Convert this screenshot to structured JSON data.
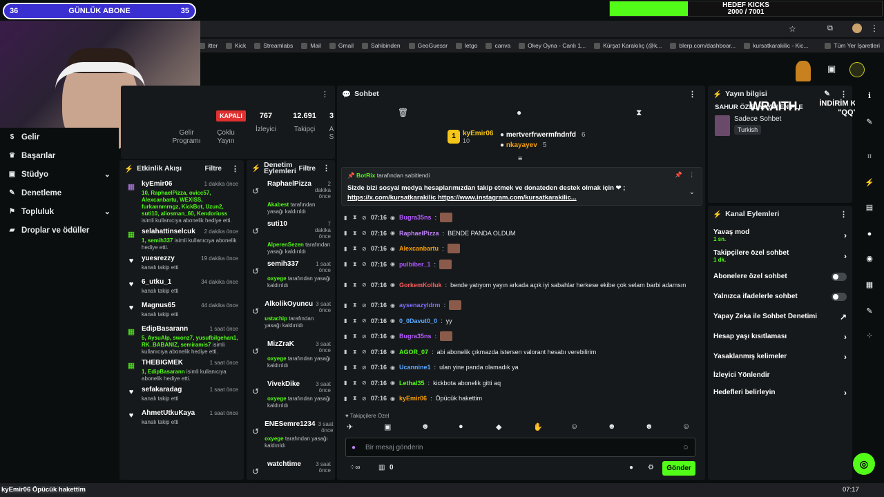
{
  "overlay": {
    "sub_goal": {
      "left": "36",
      "label": "GÜNLÜK ABONE",
      "right": "35"
    },
    "kick_goal": {
      "title": "HEDEF KICKS",
      "value": "2000 / 7001",
      "progress": 0.286
    }
  },
  "bookmarks": [
    "itter",
    "Kick",
    "Streamlabs",
    "Mail",
    "Gmail",
    "Sahibinden",
    "GeoGuessr",
    "letgo",
    "canva",
    "Okey Oyna - Canlı 1...",
    "Kürşat Karakılıç (@k...",
    "blerp.com/dashboar...",
    "kursatkarakilic - Kic...",
    "Tüm Yer İşaretleri"
  ],
  "leftnav": [
    {
      "label": "Gelir",
      "icon": "dollar-icon"
    },
    {
      "label": "Başarılar",
      "icon": "trophy-icon"
    },
    {
      "label": "Stüdyo",
      "icon": "studio-icon",
      "chev": "⌄"
    },
    {
      "label": "Denetleme",
      "icon": "wrench-icon"
    },
    {
      "label": "Topluluk",
      "icon": "users-icon",
      "chev": "⌄"
    },
    {
      "label": "Droplar ve ödüller",
      "icon": "gift-icon"
    }
  ],
  "stats": {
    "income_label": "Gelir Programı",
    "status": "KAPALI",
    "status_label": "Çoklu Yayın",
    "viewers": "767",
    "viewers_label": "İzleyici",
    "followers": "12.691",
    "followers_label": "Takipçi",
    "extra": "3",
    "extra_label": "A S"
  },
  "feed": {
    "title": "Etkinlik Akışı",
    "filter": "Filtre",
    "items": [
      {
        "name": "kyEmir06",
        "time": "1 dakika önce",
        "green": "10, RaphaelPizza, ovicc57, Alexcanbartu, WEXISS, furkannmrngz, KickBot, Uzun2, suti10, aliosman_60, Kendoriuss",
        "text": "isimli kullanıcıya abonelik hediye etti.",
        "icon": "gift-icon"
      },
      {
        "name": "selahattinselcuk",
        "time": "2 dakika önce",
        "green": "1, semih337",
        "text": "isimli kullanıcıya abonelik hediye etti.",
        "icon": "gift-icon"
      },
      {
        "name": "yuesrezzy",
        "time": "19 dakika önce",
        "green": "",
        "text": "kanalı takip etti",
        "icon": "heart-icon"
      },
      {
        "name": "6_utku_1",
        "time": "34 dakika önce",
        "green": "",
        "text": "kanalı takip etti",
        "icon": "heart-icon"
      },
      {
        "name": "Magnus65",
        "time": "44 dakika önce",
        "green": "",
        "text": "kanalı takip etti",
        "icon": "heart-icon"
      },
      {
        "name": "EdipBasarann",
        "time": "1 saat önce",
        "green": "5, AysuAlp, swonz7, yusufbilgehan1, RK_BABANIZ, semiramis7",
        "text": "isimli kullanıcıya abonelik hediye etti.",
        "icon": "gift-icon"
      },
      {
        "name": "THEBIGMEK",
        "time": "1 saat önce",
        "green": "1, EdipBasarann",
        "text": "isimli kullanıcıya abonelik hediye etti.",
        "icon": "gift-icon"
      },
      {
        "name": "sefakaradag",
        "time": "1 saat önce",
        "green": "",
        "text": "kanalı takip etti",
        "icon": "heart-icon"
      },
      {
        "name": "AhmetUtkuKaya",
        "time": "1 saat önce",
        "green": "",
        "text": "kanalı takip etti",
        "icon": "heart-icon"
      }
    ]
  },
  "mod": {
    "title": "Denetim Eylemleri",
    "filter": "Filtre",
    "items": [
      {
        "name": "RaphaelPizza",
        "time": "2 dakika önce",
        "by": "Akabest",
        "text": "tarafından yasağı kaldırıldı"
      },
      {
        "name": "suti10",
        "time": "7 dakika önce",
        "by": "AlperenSezen",
        "text": "tarafından yasağı kaldırıldı"
      },
      {
        "name": "semih337",
        "time": "1 saat önce",
        "by": "oxyege",
        "text": "tarafından yasağı kaldırıldı"
      },
      {
        "name": "AlkolikOyuncu",
        "time": "3 saat önce",
        "by": "ustachip",
        "text": "tarafından yasağı kaldırıldı"
      },
      {
        "name": "MizZraK",
        "time": "3 saat önce",
        "by": "oxyege",
        "text": "tarafından yasağı kaldırıldı"
      },
      {
        "name": "VivekDike",
        "time": "3 saat önce",
        "by": "oxyege",
        "text": "tarafından yasağı kaldırıldı"
      },
      {
        "name": "ENESemre1234",
        "time": "3 saat önce",
        "by": "oxyege",
        "text": "tarafından yasağı kaldırıldı"
      },
      {
        "name": "watchtime",
        "time": "3 saat önce",
        "by": "",
        "text": ""
      }
    ]
  },
  "chat": {
    "title": "Sohbet",
    "gifters": [
      {
        "name": "kyEmir06",
        "count": "10"
      },
      {
        "name": "mertverfrwermfndnfd",
        "count": "6"
      },
      {
        "name": "nkayayev",
        "count": "5"
      }
    ],
    "pinned": {
      "by": "BotRix",
      "by_suffix": "tarafından sabitlendi",
      "text": "Sizde bizi sosyal medya hesaplarımızdan takip etmek ve donateden destek olmak için ❤ ;",
      "links": "https://x.com/kursatkarakilic https://www.instagram.com/kursatkarakilic..."
    },
    "messages": [
      {
        "time": "07:16",
        "user": "Bugra35ns",
        "color": "#b65cff",
        "text": "",
        "emote": true
      },
      {
        "time": "07:16",
        "user": "RaphaelPizza",
        "color": "#c084fc",
        "text": "BENDE PANDA OLDUM",
        "emote": false
      },
      {
        "time": "07:16",
        "user": "Alexcanbartu",
        "color": "#f59e0b",
        "text": "",
        "emote": true
      },
      {
        "time": "07:16",
        "user": "pulbiber_1",
        "color": "#a855f7",
        "text": "",
        "emote": true
      },
      {
        "time": "07:16",
        "user": "GorkemKolluk",
        "color": "#ff5c5c",
        "text": "bende yatıyom yayın arkada açık iyi sabahlar herkese ekibe çok selam barbi adamsın",
        "emote": false
      },
      {
        "time": "07:16",
        "user": "aysenazyldrm",
        "color": "#7c6cff",
        "text": "",
        "emote": true
      },
      {
        "time": "07:16",
        "user": "0_0Davut0_0",
        "color": "#5aa9ff",
        "text": "yy",
        "emote": false
      },
      {
        "time": "07:16",
        "user": "Bugra35ns",
        "color": "#b65cff",
        "text": "",
        "emote": true
      },
      {
        "time": "07:16",
        "user": "AGOR_07",
        "color": "#53fc18",
        "text": "abi abonelik çıkmazda istersen valorant hesabı verebilirim",
        "emote": false
      },
      {
        "time": "07:16",
        "user": "Ucannine1",
        "color": "#5aa9ff",
        "text": "ulan yine panda olamadık ya",
        "emote": false
      },
      {
        "time": "07:16",
        "user": "Lethal35",
        "color": "#53fc18",
        "text": "kickbota abonelik gitti aq",
        "emote": false
      },
      {
        "time": "07:16",
        "user": "kyEmir06",
        "color": "#f59e0b",
        "text": "Öpücük hakettim",
        "emote": false
      }
    ],
    "followers_only": "Takipçilere Özel",
    "input_placeholder": "Bir mesaj gönderin",
    "points": "0",
    "send_label": "Gönder"
  },
  "streaminfo": {
    "title": "Yayın bilgisi",
    "stream_title": "SAHUR ÖZEL YAYIN ENİFLE",
    "category": "Sadece Sohbet",
    "language": "Turkish"
  },
  "overlay_text": {
    "wraith": "WRAITH.",
    "discount": "İNDİRİM KODU: \"QQ\""
  },
  "actions": {
    "title": "Kanal Eylemleri",
    "items": [
      {
        "label": "Yavaş mod",
        "sub": "1 sn.",
        "kind": "chev"
      },
      {
        "label": "Takipçilere özel sohbet",
        "sub": "1 dk.",
        "kind": "chev"
      },
      {
        "label": "Abonelere özel sohbet",
        "sub": "",
        "kind": "toggle"
      },
      {
        "label": "Yalnızca ifadelerle sohbet",
        "sub": "",
        "kind": "toggle"
      },
      {
        "label": "Yapay Zeka ile Sohbet Denetimi",
        "sub": "",
        "kind": "ext"
      },
      {
        "label": "Hesap yaşı kısıtlaması",
        "sub": "",
        "kind": "chev"
      },
      {
        "label": "Yasaklanmış kelimeler",
        "sub": "",
        "kind": "chev"
      },
      {
        "label": "İzleyici Yönlendir",
        "sub": "",
        "kind": "none"
      },
      {
        "label": "Hedefleri belirleyin",
        "sub": "",
        "kind": "chev"
      }
    ]
  },
  "taskbar": {
    "ticker": "kyEmir06 Öpücük hakettim",
    "time": "07:17"
  },
  "colors": {
    "accent": "#53fc18",
    "panel": "#16191b",
    "bg": "#0b0e0f"
  }
}
